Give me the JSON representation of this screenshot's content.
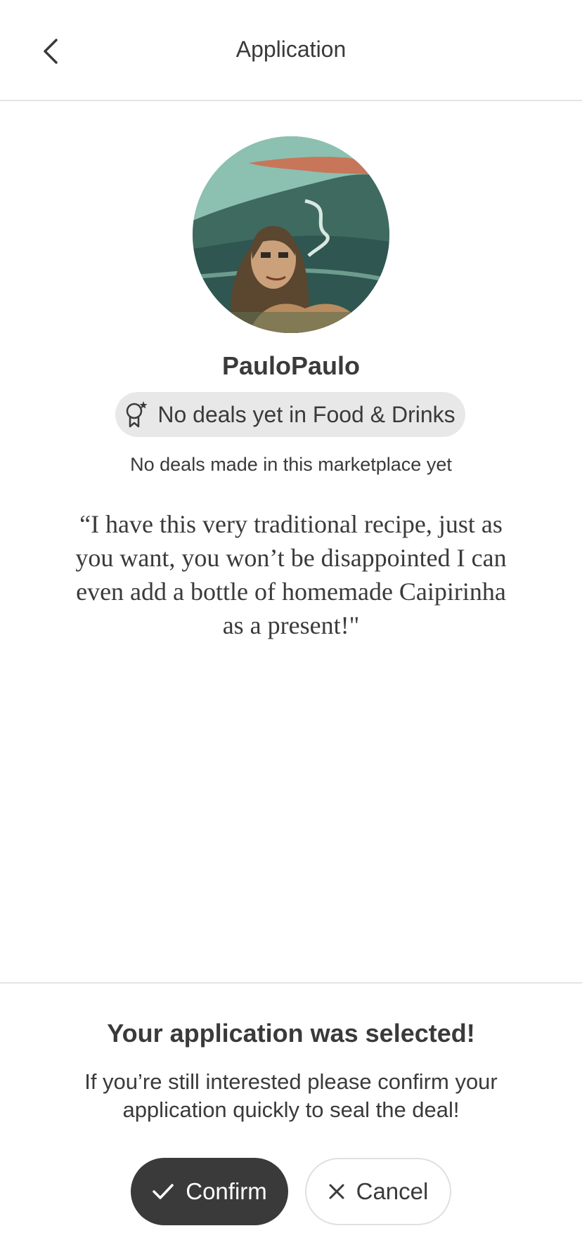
{
  "header": {
    "title": "Application",
    "back_icon": "chevron-left-icon"
  },
  "profile": {
    "username": "PauloPaulo",
    "badge_icon": "award-ribbon-icon",
    "badge_text": "No deals yet in Food & Drinks",
    "deals_note": "No deals made in this marketplace yet",
    "quote_lines": [
      "“I have this very traditional recipe, just as",
      "you want, you won’t be disappointed I can",
      "even add a bottle of homemade Caipirinha",
      "as a present!\""
    ]
  },
  "footer": {
    "title": "Your application was selected!",
    "body_lines": [
      "If you’re still interested please confirm your",
      "application quickly to seal the deal!"
    ],
    "confirm_label": "Confirm",
    "confirm_icon": "checkmark-icon",
    "cancel_label": "Cancel",
    "cancel_icon": "close-icon"
  },
  "colors": {
    "text": "#3a3a3a",
    "badge_bg": "#e8e8e8",
    "divider": "#e3e3e3",
    "confirm_bg": "#3a3a3a"
  }
}
